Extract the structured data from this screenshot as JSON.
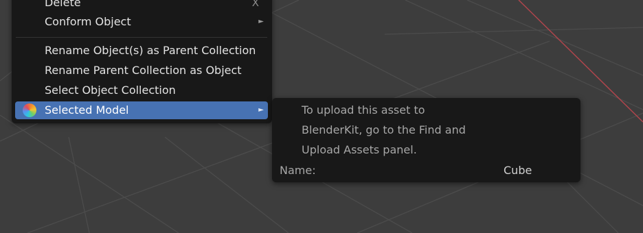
{
  "menu": {
    "items": [
      {
        "label": "Delete",
        "shortcut": "X"
      },
      {
        "label": "Conform Object",
        "has_submenu": true
      },
      {
        "label": "Rename Object(s) as Parent Collection"
      },
      {
        "label": "Rename Parent Collection as Object"
      },
      {
        "label": "Select Object Collection"
      },
      {
        "label": "Selected Model",
        "has_submenu": true,
        "active": true,
        "icon": "blenderkit-ball-icon"
      }
    ],
    "submenu_arrow": "►"
  },
  "tooltip": {
    "lines": [
      "To upload this asset to",
      "BlenderKit, go to the Find and",
      "Upload Assets panel."
    ],
    "name_label": "Name:",
    "name_value": "Cube"
  },
  "colors": {
    "viewport": "#3d3d3d",
    "grid": "#4d4d4d",
    "x_axis": "#b0454c",
    "menu_bg": "#181818",
    "highlight": "#4772b3"
  }
}
